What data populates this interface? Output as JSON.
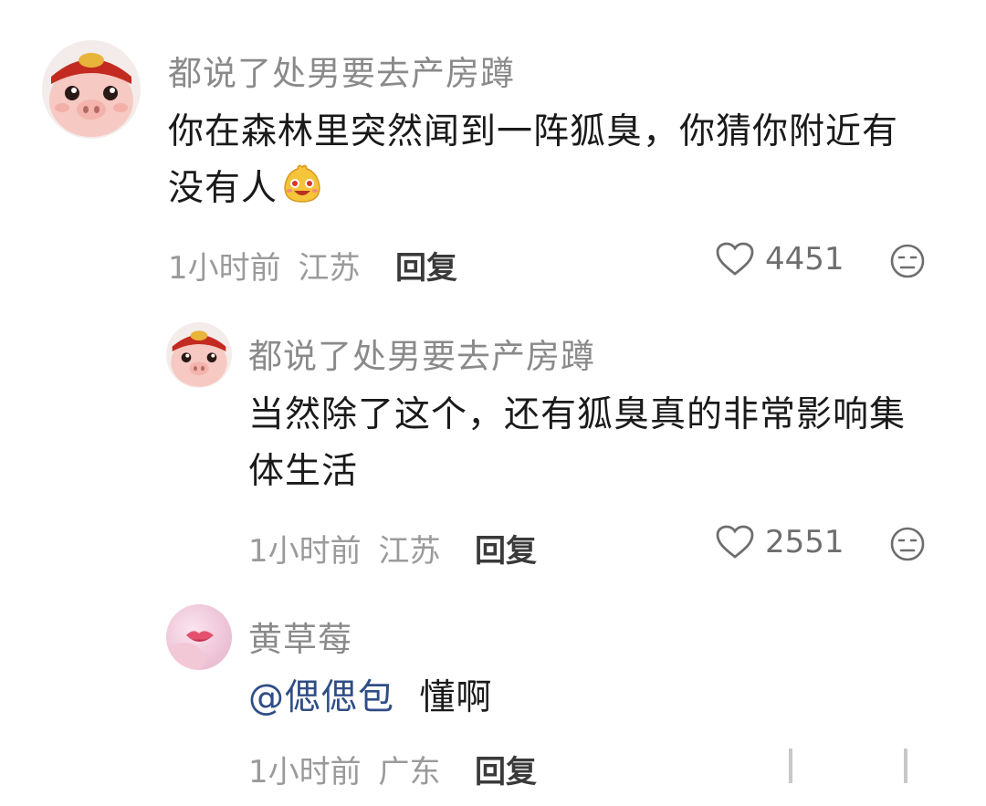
{
  "comments": [
    {
      "username": "都说了处男要去产房蹲",
      "text_line1": "你在森林里突然闻到一阵狐臭，你猜你附近有",
      "text_line2": "没有人",
      "emoji": "grinning-face-emoji",
      "time": "1小时前",
      "location": "江苏",
      "reply_label": "回复",
      "likes": "4451",
      "avatar": "pig-avatar-icon"
    },
    {
      "username": "都说了处男要去产房蹲",
      "text_line1": "当然除了这个，还有狐臭真的非常影响集",
      "text_line2": "体生活",
      "time": "1小时前",
      "location": "江苏",
      "reply_label": "回复",
      "likes": "2551",
      "avatar": "pig-avatar-icon"
    },
    {
      "username": "黄草莓",
      "mention": "@偲偲包",
      "text": "懂啊",
      "time": "1小时前",
      "location": "广东",
      "reply_label": "回复",
      "avatar": "lips-avatar-icon"
    }
  ]
}
